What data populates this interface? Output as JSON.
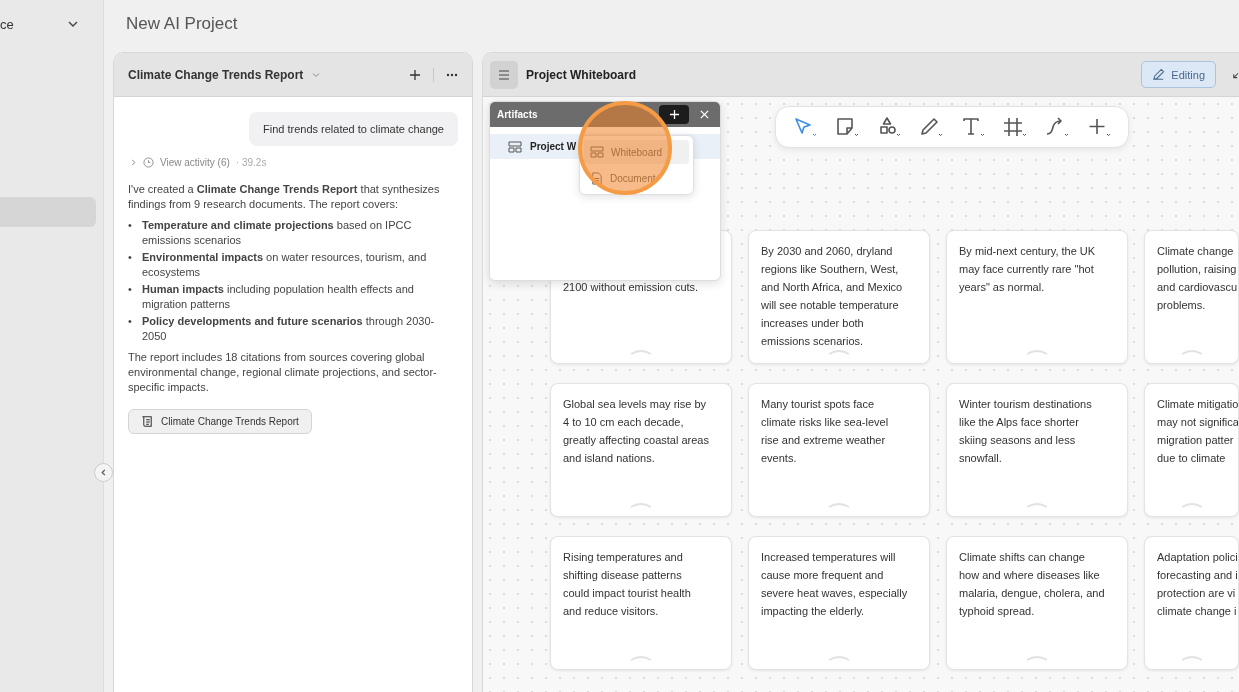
{
  "sidebar": {
    "header": "ce",
    "expanded": true
  },
  "project_title": "New AI Project",
  "chat": {
    "title": "Climate Change Trends Report",
    "user_message": "Find trends related to climate change",
    "activity": {
      "label": "View activity (6)",
      "duration": "· 39.2s"
    },
    "intro": "I've created a **Climate Change Trends Report** that synthesizes findings from 9 research documents. The report covers:",
    "bullets": [
      {
        "marker": "•",
        "text": "**Temperature and climate projections** based on IPCC emissions scenarios"
      },
      {
        "marker": "•",
        "text": "**Environmental impacts** on water resources, tourism, and ecosystems"
      },
      {
        "marker": "•",
        "text": "**Human impacts** including population health effects and migration patterns"
      },
      {
        "marker": "•",
        "text": "**Policy developments and future scenarios** through 2030-2050"
      }
    ],
    "outro": "The report includes 18 citations from sources covering global environmental change, regional climate projections, and sector-specific impacts.",
    "artifact_button": "Climate Change Trends Report"
  },
  "whiteboard": {
    "title": "Project Whiteboard",
    "mode_button": "Editing",
    "tools": [
      {
        "kind": "select",
        "selected": true
      },
      {
        "kind": "note",
        "selected": false
      },
      {
        "kind": "shapes",
        "selected": false
      },
      {
        "kind": "pen",
        "selected": false
      },
      {
        "kind": "text",
        "selected": false
      },
      {
        "kind": "frame",
        "selected": false
      },
      {
        "kind": "connector",
        "selected": false
      },
      {
        "kind": "add",
        "selected": false
      }
    ],
    "cards": [
      {
        "kind": "covered",
        "lines": [
          "2100 without emission cuts."
        ]
      },
      {
        "kind": "full",
        "lines": [
          "By 2030 and 2060, dryland",
          "regions like Southern, West,",
          "and North Africa, and Mexico",
          "will see notable temperature",
          "increases under both",
          "emissions scenarios."
        ]
      },
      {
        "kind": "full",
        "lines": [
          "By mid-next century, the UK",
          "may face currently rare \"hot",
          "years\" as normal."
        ]
      },
      {
        "kind": "full",
        "lines": [
          "Climate change",
          "pollution, raising",
          "and cardiovascu",
          "problems."
        ]
      },
      {
        "kind": "full",
        "lines": [
          "Global sea levels may rise by",
          "4 to 10 cm each decade,",
          "greatly affecting coastal areas",
          "and island nations."
        ]
      },
      {
        "kind": "full",
        "lines": [
          "Many tourist spots face",
          "climate risks like sea-level",
          "rise and extreme weather",
          "events."
        ]
      },
      {
        "kind": "full",
        "lines": [
          "Winter tourism destinations",
          "like the Alps face shorter",
          "skiing seasons and less",
          "snowfall."
        ]
      },
      {
        "kind": "full",
        "lines": [
          "Climate mitigatio",
          "may not significa",
          "migration patter",
          "due to climate"
        ]
      },
      {
        "kind": "full",
        "lines": [
          "Rising temperatures and",
          "shifting disease patterns",
          "could impact tourist health",
          "and reduce visitors."
        ]
      },
      {
        "kind": "full",
        "lines": [
          "Increased temperatures will",
          "cause more frequent and",
          "severe heat waves, especially",
          "impacting the elderly."
        ]
      },
      {
        "kind": "full",
        "lines": [
          "Climate shifts can change",
          "how and where diseases like",
          "malaria, dengue, cholera, and",
          "typhoid spread."
        ]
      },
      {
        "kind": "full",
        "lines": [
          "Adaptation polici",
          "forecasting and i",
          "protection are vi",
          "climate change i"
        ]
      }
    ]
  },
  "artifacts_popover": {
    "title": "Artifacts",
    "items": [
      {
        "label": "Project W",
        "selected": true
      }
    ],
    "menu": [
      {
        "kind": "whiteboard",
        "label": "Whiteboard",
        "selected": true
      },
      {
        "kind": "document",
        "label": "Document",
        "selected": false
      }
    ]
  }
}
